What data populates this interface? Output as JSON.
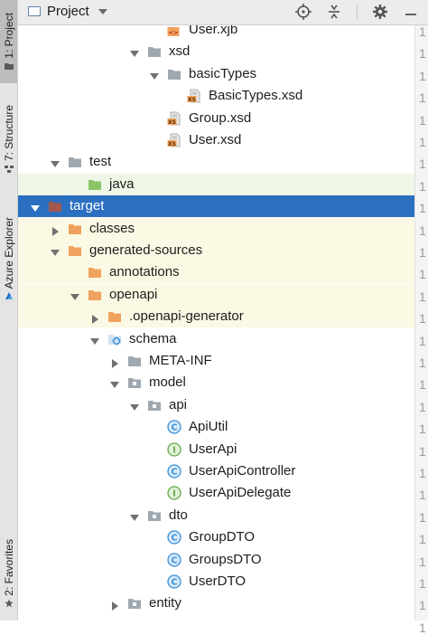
{
  "tool_windows": {
    "project": "1: Project",
    "structure": "7: Structure",
    "azure": "Azure Explorer",
    "favorites": "2: Favorites"
  },
  "header": {
    "title": "Project",
    "buttons": [
      "locate-icon",
      "collapse-all-icon",
      "settings-icon",
      "hide-icon"
    ]
  },
  "tree": {
    "rows": [
      {
        "label": "User.xjb",
        "icon": "xjb-file-icon",
        "expander": "none",
        "highlight": "none"
      },
      {
        "label": "xsd",
        "icon": "folder-gray-icon",
        "expander": "expanded",
        "highlight": "none"
      },
      {
        "label": "basicTypes",
        "icon": "folder-gray-icon",
        "expander": "expanded",
        "highlight": "none"
      },
      {
        "label": "BasicTypes.xsd",
        "icon": "xsd-file-icon",
        "expander": "none",
        "highlight": "none"
      },
      {
        "label": "Group.xsd",
        "icon": "xsd-file-icon",
        "expander": "none",
        "highlight": "none"
      },
      {
        "label": "User.xsd",
        "icon": "xsd-file-icon",
        "expander": "none",
        "highlight": "none"
      },
      {
        "label": "test",
        "icon": "folder-gray-icon",
        "expander": "expanded",
        "highlight": "none"
      },
      {
        "label": "java",
        "icon": "folder-green-icon",
        "expander": "none",
        "highlight": "green"
      },
      {
        "label": "target",
        "icon": "folder-brown-icon",
        "expander": "expanded",
        "highlight": "selected"
      },
      {
        "label": "classes",
        "icon": "folder-orange-icon",
        "expander": "collapsed",
        "highlight": "yellow"
      },
      {
        "label": "generated-sources",
        "icon": "folder-orange-icon",
        "expander": "expanded",
        "highlight": "yellow"
      },
      {
        "label": "annotations",
        "icon": "folder-orange-icon",
        "expander": "none",
        "highlight": "yellow"
      },
      {
        "label": "openapi",
        "icon": "folder-orange-icon",
        "expander": "expanded",
        "highlight": "yellow"
      },
      {
        "label": ".openapi-generator",
        "icon": "folder-orange-icon",
        "expander": "collapsed",
        "highlight": "yellow"
      },
      {
        "label": "schema",
        "icon": "source-root-icon",
        "expander": "expanded",
        "highlight": "none"
      },
      {
        "label": "META-INF",
        "icon": "folder-gray-icon",
        "expander": "collapsed",
        "highlight": "none"
      },
      {
        "label": "model",
        "icon": "package-icon",
        "expander": "expanded",
        "highlight": "none"
      },
      {
        "label": "api",
        "icon": "package-icon",
        "expander": "expanded",
        "highlight": "none"
      },
      {
        "label": "ApiUtil",
        "icon": "class-icon",
        "expander": "none",
        "highlight": "none"
      },
      {
        "label": "UserApi",
        "icon": "interface-icon",
        "expander": "none",
        "highlight": "none"
      },
      {
        "label": "UserApiController",
        "icon": "class-icon",
        "expander": "none",
        "highlight": "none"
      },
      {
        "label": "UserApiDelegate",
        "icon": "interface-icon",
        "expander": "none",
        "highlight": "none"
      },
      {
        "label": "dto",
        "icon": "package-icon",
        "expander": "expanded",
        "highlight": "none"
      },
      {
        "label": "GroupDTO",
        "icon": "class-icon",
        "expander": "none",
        "highlight": "none"
      },
      {
        "label": "GroupsDTO",
        "icon": "class-icon",
        "expander": "none",
        "highlight": "none"
      },
      {
        "label": "UserDTO",
        "icon": "class-icon",
        "expander": "none",
        "highlight": "none"
      },
      {
        "label": "entity",
        "icon": "package-icon",
        "expander": "collapsed",
        "highlight": "none"
      }
    ]
  },
  "gutter": {
    "values": [
      "1",
      "1",
      "1",
      "1",
      "1",
      "1",
      "1",
      "1",
      "1",
      "1",
      "1",
      "1",
      "1",
      "1",
      "1",
      "1",
      "1",
      "1",
      "1",
      "1",
      "1",
      "1",
      "1",
      "1",
      "1",
      "1",
      "1",
      "1"
    ]
  },
  "colors": {
    "selection": "#2a6fc0",
    "green_highlight": "#eef6e6",
    "yellow_highlight": "#fbf8e3",
    "folder_gray": "#9fa8b0",
    "folder_orange": "#f0a35e",
    "folder_green": "#8cc46a",
    "folder_brown": "#a5584d",
    "class_icon": "#3a8fd6",
    "interface_icon": "#64a84b"
  }
}
